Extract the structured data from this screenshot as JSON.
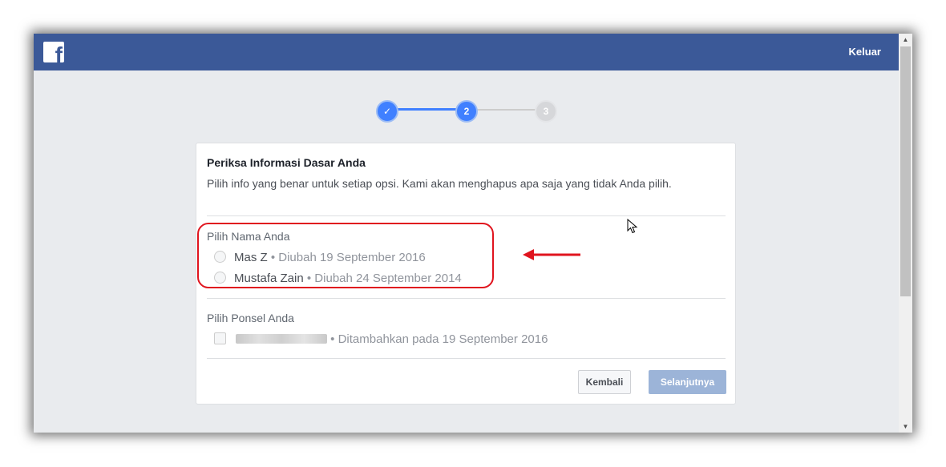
{
  "header": {
    "logo_letter": "f",
    "logout_label": "Keluar"
  },
  "stepper": {
    "steps": [
      {
        "label": "✓",
        "state": "done"
      },
      {
        "label": "2",
        "state": "current"
      },
      {
        "label": "3",
        "state": "upcoming"
      }
    ]
  },
  "card": {
    "title": "Periksa Informasi Dasar Anda",
    "description": "Pilih info yang benar untuk setiap opsi. Kami akan menghapus apa saja yang tidak Anda pilih.",
    "name_section": {
      "title": "Pilih Nama Anda",
      "options": [
        {
          "name": "Mas Z",
          "meta": " • Diubah 19 September 2016"
        },
        {
          "name": "Mustafa Zain",
          "meta": " • Diubah 24 September 2014"
        }
      ]
    },
    "phone_section": {
      "title": "Pilih Ponsel Anda",
      "options": [
        {
          "meta": " • Ditambahkan pada 19 September 2016"
        }
      ]
    },
    "buttons": {
      "back_label": "Kembali",
      "next_label": "Selanjutnya"
    }
  },
  "colors": {
    "brand": "#3b5998",
    "step_active": "#4080ff",
    "highlight": "#e0141e"
  }
}
